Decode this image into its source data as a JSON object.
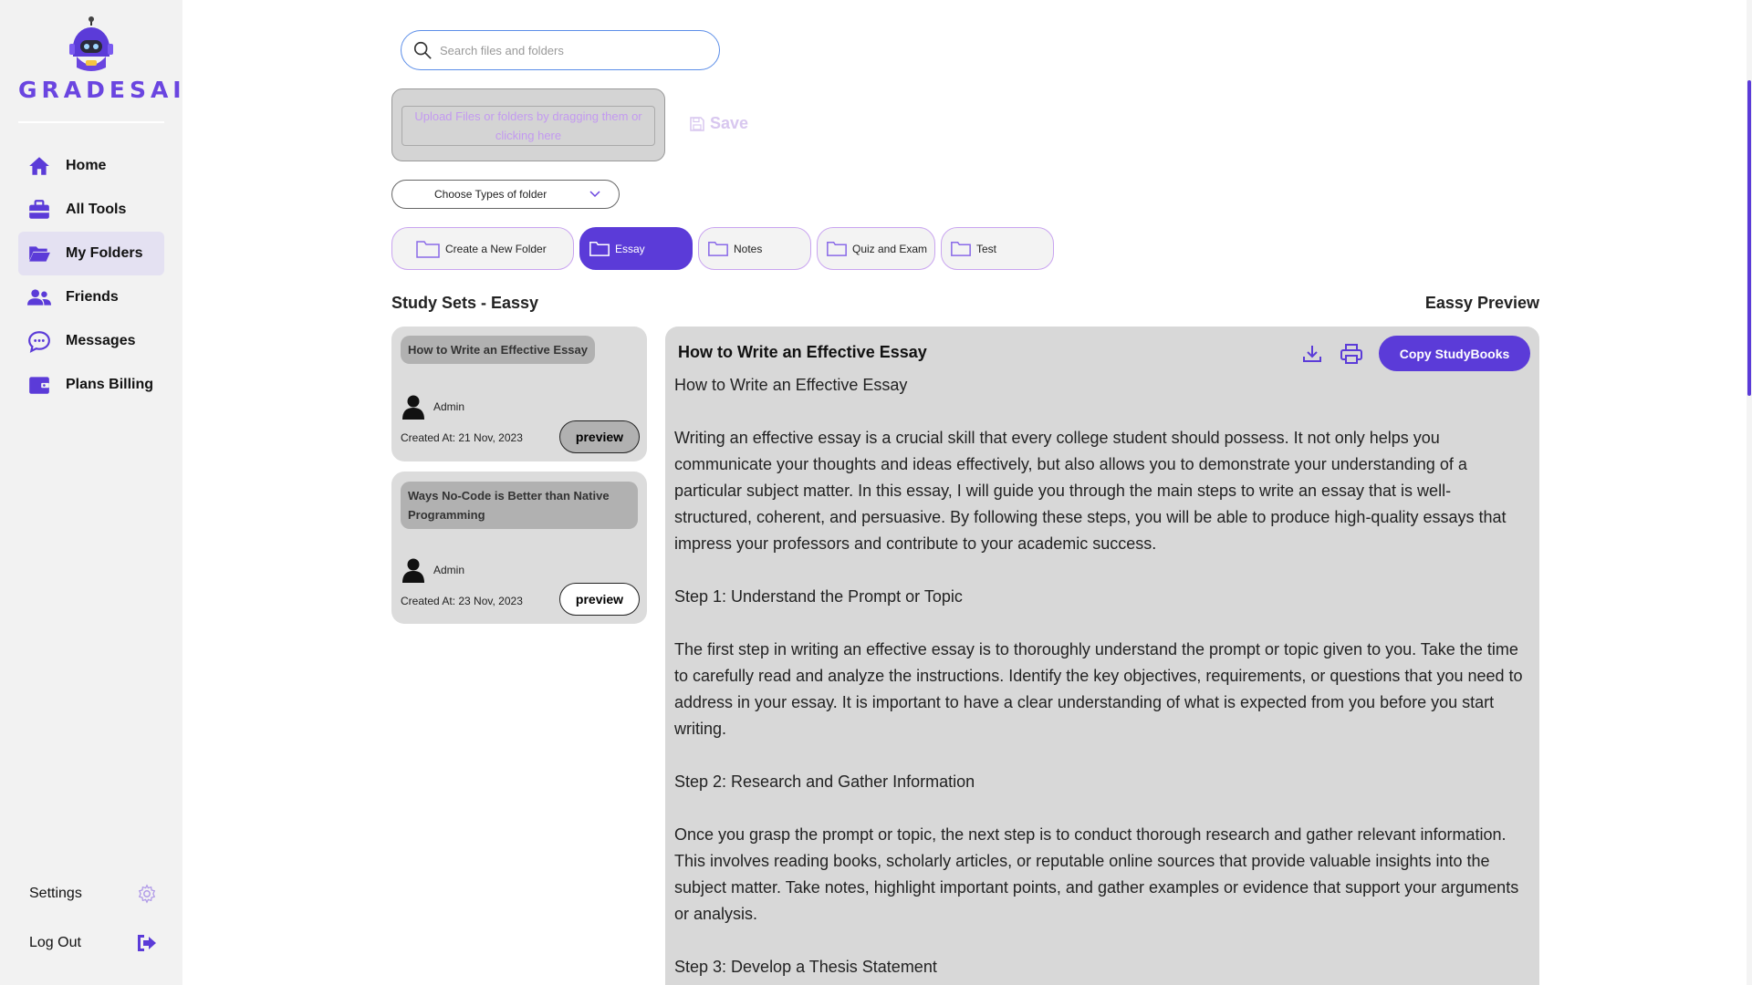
{
  "brand": {
    "name": "GRADESAI",
    "accent": "#5b3bd8"
  },
  "sidebar": {
    "items": [
      {
        "label": "Home",
        "icon": "home-icon"
      },
      {
        "label": "All Tools",
        "icon": "toolbox-icon"
      },
      {
        "label": "My Folders",
        "icon": "folder-open-icon",
        "active": true
      },
      {
        "label": "Friends",
        "icon": "users-icon"
      },
      {
        "label": "Messages",
        "icon": "chat-icon"
      },
      {
        "label": "Plans Billing",
        "icon": "wallet-icon"
      }
    ],
    "settings_label": "Settings",
    "logout_label": "Log Out"
  },
  "search": {
    "placeholder": "Search files and folders"
  },
  "upload": {
    "text": "Upload Files or folders by dragging them or clicking here"
  },
  "save_label": "Save",
  "folder_type_select": {
    "label": "Choose Types of folder"
  },
  "tabs": [
    {
      "label": "Create a New Folder"
    },
    {
      "label": "Essay",
      "active": true
    },
    {
      "label": "Notes"
    },
    {
      "label": "Quiz and Exam"
    },
    {
      "label": "Test"
    }
  ],
  "study_sets": {
    "title": "Study Sets - Eassy",
    "cards": [
      {
        "title": "How to Write an Effective Essay",
        "author": "Admin",
        "created": "Created At: 21 Nov, 2023",
        "button": "preview"
      },
      {
        "title": "Ways No-Code is Better than Native Programming",
        "author": "Admin",
        "created": "Created At: 23 Nov, 2023",
        "button": "preview"
      }
    ]
  },
  "preview": {
    "title": "Eassy Preview",
    "heading": "How to Write an Effective Essay",
    "copy_button": "Copy StudyBooks",
    "paragraphs": [
      "How to Write an Effective Essay",
      "Writing an effective essay is a crucial skill that every college student should possess. It not only helps you communicate your thoughts and ideas effectively, but also allows you to demonstrate your understanding of a particular subject matter. In this essay, I will guide you through the main steps to write an essay that is well-structured, coherent, and persuasive. By following these steps, you will be able to produce high-quality essays that impress your professors and contribute to your academic success.",
      "Step 1: Understand the Prompt or Topic",
      "The first step in writing an effective essay is to thoroughly understand the prompt or topic given to you. Take the time to carefully read and analyze the instructions. Identify the key objectives, requirements, or questions that you need to address in your essay. It is important to have a clear understanding of what is expected from you before you start writing.",
      "Step 2: Research and Gather Information",
      "Once you grasp the prompt or topic, the next step is to conduct thorough research and gather relevant information. This involves reading books, scholarly articles, or reputable online sources that provide valuable insights into the subject matter. Take notes, highlight important points, and gather examples or evidence that support your arguments or analysis.",
      "Step 3: Develop a Thesis Statement"
    ]
  }
}
